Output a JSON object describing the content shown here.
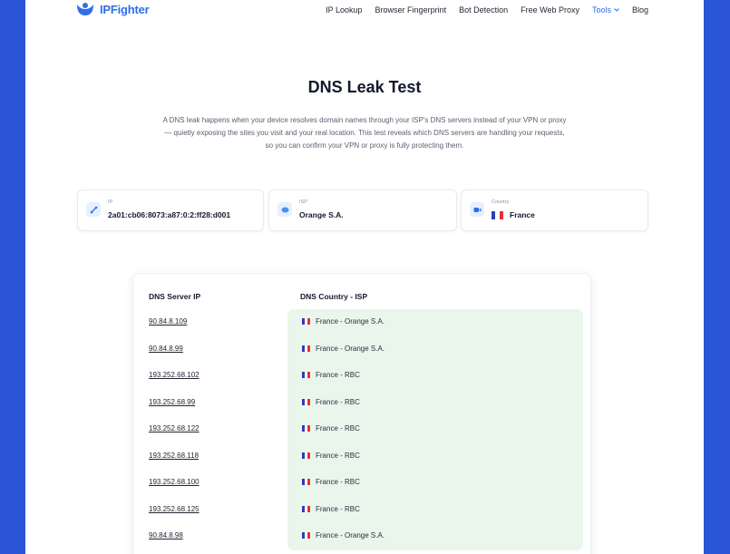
{
  "header": {
    "logo_text": "IPFighter",
    "nav": [
      "IP Lookup",
      "Browser Fingerprint",
      "Bot Detection",
      "Free Web Proxy"
    ],
    "tools_label": "Tools",
    "blog_label": "Blog"
  },
  "main": {
    "title": "DNS Leak Test",
    "intro": "A DNS leak happens when your device resolves domain names through your ISP's DNS servers instead of your VPN or proxy — quietly exposing the sites you visit and your real location. This test reveals which DNS servers are handling your requests, so you can confirm your VPN or proxy is fully protecting them."
  },
  "info": {
    "ip_label": "IP",
    "ip_value": "2a01:cb06:8073:a87:0:2:ff28:d001",
    "isp_label": "ISP",
    "isp_value": "Orange S.A.",
    "country_label": "Country",
    "country_value": "France"
  },
  "table": {
    "col_ip": "DNS Server IP",
    "col_country": "DNS Country - ISP",
    "rows": [
      {
        "ip": "90.84.8.109",
        "country": "France - Orange S.A."
      },
      {
        "ip": "90.84.8.99",
        "country": "France - Orange S.A."
      },
      {
        "ip": "193.252.68.102",
        "country": "France - RBC"
      },
      {
        "ip": "193.252.68.99",
        "country": "France - RBC"
      },
      {
        "ip": "193.252.68.122",
        "country": "France - RBC"
      },
      {
        "ip": "193.252.68.118",
        "country": "France - RBC"
      },
      {
        "ip": "193.252.68.100",
        "country": "France - RBC"
      },
      {
        "ip": "193.252.68.125",
        "country": "France - RBC"
      },
      {
        "ip": "90.84.8.98",
        "country": "France - Orange S.A."
      }
    ]
  },
  "colors": {
    "brand": "#2f6fe8",
    "frame": "#2a56d6",
    "row_highlight": "#eaf6ec"
  },
  "icons": [
    "logo-icon",
    "chevron-down-icon",
    "link-icon",
    "server-icon",
    "camera-icon",
    "france-flag-icon"
  ]
}
